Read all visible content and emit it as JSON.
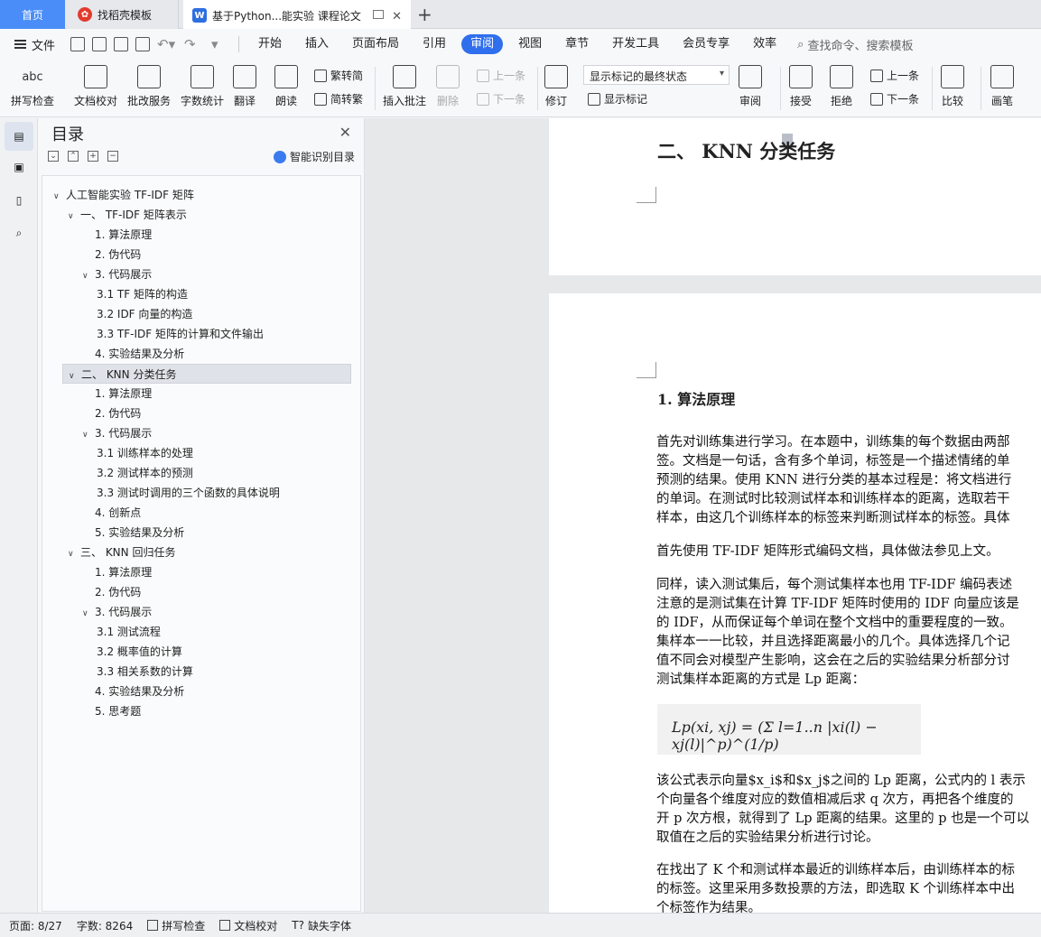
{
  "tabs": {
    "home": "首页",
    "template": "找稻壳模板",
    "document": "基于Python...能实验 课程论文"
  },
  "menu": {
    "file": "文件",
    "items": [
      "开始",
      "插入",
      "页面布局",
      "引用",
      "审阅",
      "视图",
      "章节",
      "开发工具",
      "会员专享",
      "效率"
    ],
    "active": "审阅",
    "search_placeholder": "查找命令、搜索模板"
  },
  "ribbon": {
    "spell_check": "拼写检查",
    "doc_proofread": "文档校对",
    "grading": "批改服务",
    "word_count": "字数统计",
    "translate": "翻译",
    "read_aloud": "朗读",
    "trad_to_simp": "繁转简",
    "simp_to_trad": "简转繁",
    "insert_comment": "插入批注",
    "delete": "删除",
    "prev": "上一条",
    "next": "下一条",
    "track_changes": "修订",
    "markup_select": "显示标记的最终状态",
    "show_markup": "显示标记",
    "review": "审阅",
    "accept": "接受",
    "reject": "拒绝",
    "prev2": "上一条",
    "next2": "下一条",
    "compare": "比较",
    "draw": "画笔",
    "abc": "abc"
  },
  "toc": {
    "title": "目录",
    "smart": "智能识别目录",
    "items": [
      {
        "label": "人工智能实验 TF-IDF 矩阵",
        "level": 0,
        "chev": true
      },
      {
        "label": "一、  TF-IDF 矩阵表示",
        "level": 1,
        "chev": true
      },
      {
        "label": "1. 算法原理",
        "level": 2,
        "chev": false
      },
      {
        "label": "2. 伪代码",
        "level": 2,
        "chev": false
      },
      {
        "label": "3. 代码展示",
        "level": 2,
        "chev": true
      },
      {
        "label": "3.1 TF 矩阵的构造",
        "level": 3,
        "chev": false
      },
      {
        "label": "3.2 IDF 向量的构造",
        "level": 3,
        "chev": false
      },
      {
        "label": "3.3 TF-IDF 矩阵的计算和文件输出",
        "level": 3,
        "chev": false
      },
      {
        "label": "4. 实验结果及分析",
        "level": 2,
        "chev": false
      },
      {
        "label": "二、  KNN 分类任务",
        "level": 1,
        "chev": true,
        "selected": true
      },
      {
        "label": "1. 算法原理",
        "level": 2,
        "chev": false
      },
      {
        "label": "2. 伪代码",
        "level": 2,
        "chev": false
      },
      {
        "label": "3. 代码展示",
        "level": 2,
        "chev": true
      },
      {
        "label": "3.1  训练样本的处理",
        "level": 3,
        "chev": false
      },
      {
        "label": "3.2  测试样本的预测",
        "level": 3,
        "chev": false
      },
      {
        "label": "3.3  测试时调用的三个函数的具体说明",
        "level": 3,
        "chev": false
      },
      {
        "label": "4. 创新点",
        "level": 2,
        "chev": false
      },
      {
        "label": "5. 实验结果及分析",
        "level": 2,
        "chev": false
      },
      {
        "label": "三、  KNN 回归任务",
        "level": 1,
        "chev": true
      },
      {
        "label": "1. 算法原理",
        "level": 2,
        "chev": false
      },
      {
        "label": "2. 伪代码",
        "level": 2,
        "chev": false
      },
      {
        "label": "3. 代码展示",
        "level": 2,
        "chev": true
      },
      {
        "label": "3.1  测试流程",
        "level": 3,
        "chev": false
      },
      {
        "label": "3.2  概率值的计算",
        "level": 3,
        "chev": false
      },
      {
        "label": "3.3  相关系数的计算",
        "level": 3,
        "chev": false
      },
      {
        "label": "4. 实验结果及分析",
        "level": 2,
        "chev": false
      },
      {
        "label": "5. 思考题",
        "level": 2,
        "chev": false
      }
    ]
  },
  "document": {
    "section_heading": "二、  KNN 分类任务",
    "subheading": "1. 算法原理",
    "paragraphs": [
      [
        "首先对训练集进行学习。在本题中，训练集的每个数据由两部",
        "签。文档是一句话，含有多个单词，标签是一个描述情绪的单",
        "预测的结果。使用 KNN 进行分类的基本过程是：将文档进行",
        "的单词。在测试时比较测试样本和训练样本的距离，选取若干",
        "样本，由这几个训练样本的标签来判断测试样本的标签。具体"
      ],
      [
        "首先使用 TF-IDF 矩阵形式编码文档，具体做法参见上文。"
      ],
      [
        "同样，读入测试集后，每个测试集样本也用 TF-IDF 编码表述",
        "注意的是测试集在计算 TF-IDF 矩阵时使用的 IDF 向量应该是",
        "的 IDF，从而保证每个单词在整个文档中的重要程度的一致。",
        "集样本一一比较，并且选择距离最小的几个。具体选择几个记",
        "值不同会对模型产生影响，这会在之后的实验结果分析部分讨",
        "测试集样本距离的方式是 Lp 距离："
      ],
      [
        "该公式表示向量$x_i$和$x_j$之间的 Lp 距离，公式内的 l 表示",
        "个向量各个维度对应的数值相减后求 q 次方，再把各个维度的",
        "开 p 次方根，就得到了 Lp 距离的结果。这里的 p 也是一个可以",
        "取值在之后的实验结果分析进行讨论。"
      ],
      [
        "在找出了 K 个和测试样本最近的训练样本后，由训练样本的标",
        "的标签。这里采用多数投票的方法，即选取 K 个训练样本中出",
        "个标签作为结果。"
      ]
    ],
    "formula": "Lp(xi, xj) = (Σ l=1..n |xi(l) − xj(l)|^p)^(1/p)"
  },
  "status": {
    "page": "页面: 8/27",
    "words": "字数: 8264",
    "spell": "拼写检查",
    "proof": "文档校对",
    "missing_font": "缺失字体"
  }
}
